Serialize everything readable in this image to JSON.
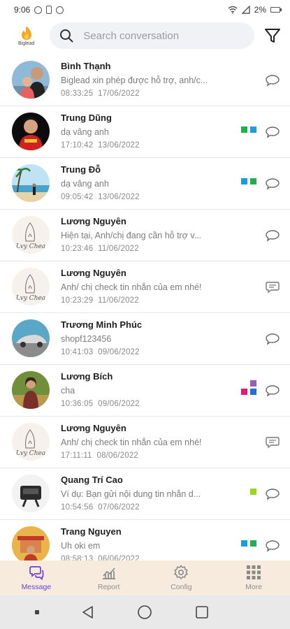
{
  "status_bar": {
    "time": "9:06",
    "battery": "2%"
  },
  "header": {
    "logo_text": "Biglead",
    "search_placeholder": "Search conversation"
  },
  "conversations": [
    {
      "name": "Bình Thạnh",
      "message": "Biglead xin phép được hỗ trợ, anh/c...",
      "time": "08:33:25",
      "date": "17/06/2022",
      "tags": [],
      "avatar": "couple-photo"
    },
    {
      "name": "Trung Dũng",
      "message": "dạ vâng anh",
      "time": "17:10:42",
      "date": "13/06/2022",
      "tags": [
        "#1fb04b",
        "#1e9be0"
      ],
      "avatar": "man-red-shirt"
    },
    {
      "name": "Trung Đỗ",
      "message": "dạ vâng anh",
      "time": "09:05:42",
      "date": "13/06/2022",
      "tags": [
        "#1e9be0",
        "#1fb04b"
      ],
      "avatar": "beach-photo"
    },
    {
      "name": "Lương Nguyên",
      "message": "Hiện tại, Anh/chị đang cần hỗ trợ v...",
      "time": "10:23:46",
      "date": "11/06/2022",
      "tags": [],
      "avatar": "sketch-logo"
    },
    {
      "name": "Lương Nguyên",
      "message": "Anh/ chị check tin nhắn của em nhé!",
      "time": "10:23:29",
      "date": "11/06/2022",
      "tags": [],
      "avatar": "sketch-logo"
    },
    {
      "name": "Trương Minh Phúc",
      "message": "shopf123456",
      "time": "10:41:03",
      "date": "09/06/2022",
      "tags": [],
      "avatar": "car-photo"
    },
    {
      "name": "Lương Bích",
      "message": "cha",
      "time": "10:36:05",
      "date": "09/06/2022",
      "tags": [
        "#9b59b6",
        "#e0197d",
        "#1e6fd9"
      ],
      "avatar": "woman-field"
    },
    {
      "name": "Lương Nguyên",
      "message": "Anh/ chị check tin nhắn của em nhé!",
      "time": "17:11:11",
      "date": "08/06/2022",
      "tags": [],
      "avatar": "sketch-logo"
    },
    {
      "name": "Quang Trí Cao",
      "message": "Ví dụ:  Bạn gửi nội dung tin nhắn d...",
      "time": "10:54:56",
      "date": "07/06/2022",
      "tags": [
        "#9ad61e"
      ],
      "avatar": "device-photo"
    },
    {
      "name": "Trang Nguyen",
      "message": "Uh oki em",
      "time": "08:58:13",
      "date": "06/06/2022",
      "tags": [
        "#1e9be0",
        "#1fb04b"
      ],
      "avatar": "temple-photo"
    }
  ],
  "bottom_nav": [
    {
      "label": "Message",
      "icon": "message-icon",
      "active": true
    },
    {
      "label": "Report",
      "icon": "report-icon",
      "active": false
    },
    {
      "label": "Config",
      "icon": "gear-icon",
      "active": false
    },
    {
      "label": "More",
      "icon": "grid-icon",
      "active": false
    }
  ],
  "colors": {
    "accent": "#6a3fd6",
    "nav_bg": "#f6ebdc",
    "search_bg": "#f1f2f6"
  }
}
